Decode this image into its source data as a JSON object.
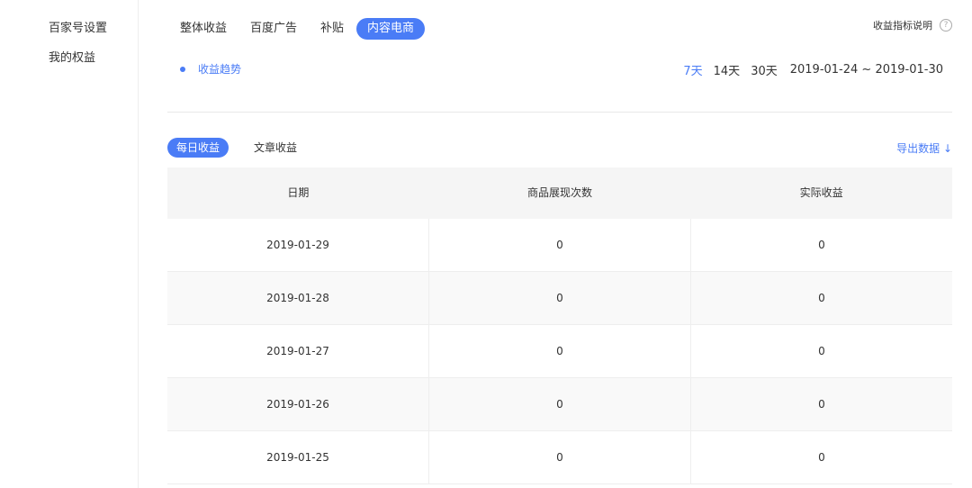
{
  "sidebar": {
    "items": [
      {
        "label": "百家号设置"
      },
      {
        "label": "我的权益"
      }
    ]
  },
  "tabs": [
    {
      "label": "整体收益"
    },
    {
      "label": "百度广告"
    },
    {
      "label": "补贴"
    },
    {
      "label": "内容电商",
      "active": true
    }
  ],
  "help": {
    "label": "收益指标说明",
    "icon": "question-circle-icon",
    "icon_glyph": "?"
  },
  "trend": {
    "label": "收益趋势"
  },
  "ranges": {
    "options": [
      "7天",
      "14天",
      "30天"
    ],
    "active": "7天",
    "date_range": "2019-01-24 ~ 2019-01-30"
  },
  "subtabs": [
    {
      "label": "每日收益",
      "active": true
    },
    {
      "label": "文章收益"
    }
  ],
  "export": {
    "label": "导出数据 ↓"
  },
  "table": {
    "headers": [
      "日期",
      "商品展现次数",
      "实际收益"
    ],
    "rows": [
      [
        "2019-01-29",
        "0",
        "0"
      ],
      [
        "2019-01-28",
        "0",
        "0"
      ],
      [
        "2019-01-27",
        "0",
        "0"
      ],
      [
        "2019-01-26",
        "0",
        "0"
      ],
      [
        "2019-01-25",
        "0",
        "0"
      ]
    ]
  },
  "colors": {
    "accent": "#4a7cf6",
    "header_bg": "#f5f5f5",
    "alt_row_bg": "#f9f9f9"
  }
}
